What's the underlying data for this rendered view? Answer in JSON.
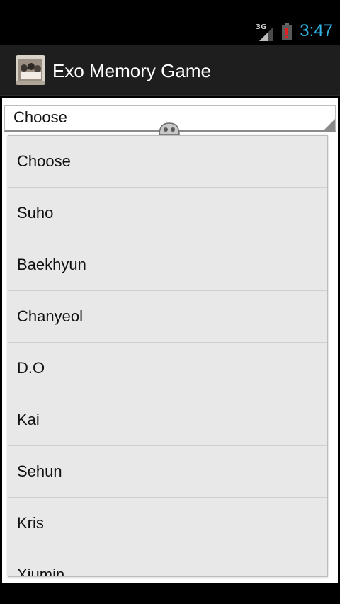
{
  "status_bar": {
    "network_label": "3G",
    "time": "3:47",
    "icons": [
      "network-3g-icon",
      "signal-icon",
      "battery-alert-icon"
    ],
    "time_color": "#33b5e5"
  },
  "action_bar": {
    "title": "Exo Memory Game",
    "icon": "app-icon"
  },
  "spinner": {
    "selected_label": "Choose"
  },
  "dropdown": {
    "items": [
      {
        "label": "Choose"
      },
      {
        "label": "Suho"
      },
      {
        "label": "Baekhyun"
      },
      {
        "label": "Chanyeol"
      },
      {
        "label": "D.O"
      },
      {
        "label": "Kai"
      },
      {
        "label": "Sehun"
      },
      {
        "label": "Kris"
      },
      {
        "label": "Xiumin"
      }
    ]
  }
}
